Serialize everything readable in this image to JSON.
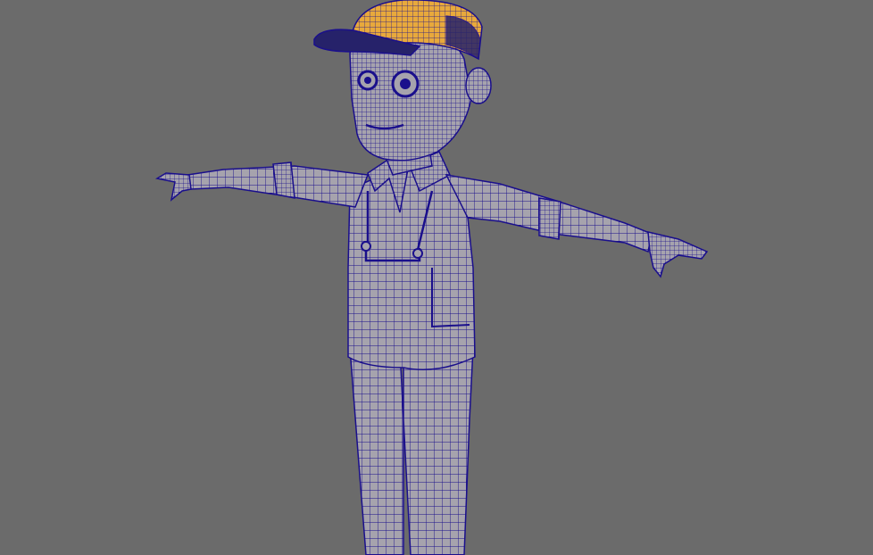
{
  "viewport": {
    "background_color": "#6b6b6b",
    "display_mode": "wireframe-on-shaded"
  },
  "model": {
    "subject": "character-t-pose",
    "mesh_fill_color": "#a6a3ad",
    "wire_color": "#1a0f8c",
    "cap_color": "#e8a93c",
    "cap_brim_color": "#26226a",
    "selected_part": "cap"
  }
}
